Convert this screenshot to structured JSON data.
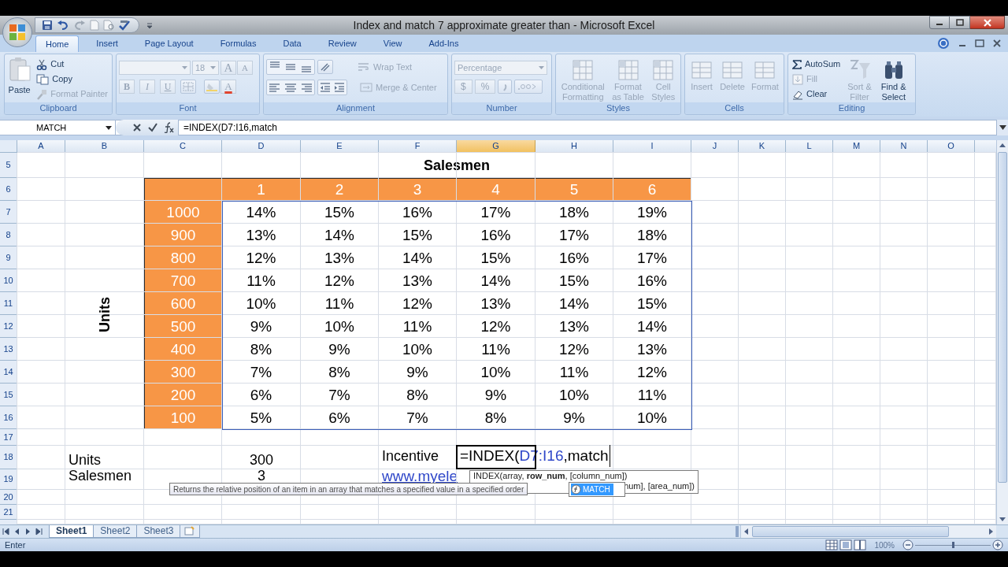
{
  "window": {
    "title": "Index and match 7 approximate greater than - Microsoft Excel"
  },
  "ribbon_tabs": [
    {
      "label": "Home",
      "selected": true
    },
    {
      "label": "Insert",
      "selected": false
    },
    {
      "label": "Page Layout",
      "selected": false
    },
    {
      "label": "Formulas",
      "selected": false
    },
    {
      "label": "Data",
      "selected": false
    },
    {
      "label": "Review",
      "selected": false
    },
    {
      "label": "View",
      "selected": false
    },
    {
      "label": "Add-Ins",
      "selected": false
    }
  ],
  "ribbon_groups": [
    {
      "kind": "clipboard",
      "label": "Clipboard",
      "items": [
        {
          "label": "Paste",
          "disabled": false
        },
        {
          "label": "Cut",
          "disabled": false
        },
        {
          "label": "Copy",
          "disabled": false
        },
        {
          "label": "Format Painter",
          "disabled": true
        }
      ]
    },
    {
      "kind": "font",
      "label": "Font",
      "font_size": "18",
      "items": [
        {
          "kind": "grow",
          "label": "A"
        },
        {
          "kind": "shrink",
          "label": "A"
        },
        {
          "kind": "bold",
          "label": "B"
        },
        {
          "kind": "italic",
          "label": "I"
        },
        {
          "kind": "underline",
          "label": "U"
        },
        {
          "kind": "color",
          "label": "A"
        }
      ]
    },
    {
      "kind": "alignment",
      "label": "Alignment",
      "items": [
        {
          "label": "Wrap Text",
          "disabled": true
        },
        {
          "label": "Merge & Center",
          "disabled": true
        }
      ]
    },
    {
      "kind": "number",
      "label": "Number",
      "format": "Percentage",
      "items": [
        {
          "label": "$"
        },
        {
          "label": "%"
        }
      ]
    },
    {
      "kind": "large",
      "label": "Styles",
      "items": [
        {
          "lines": [
            "Conditional",
            "Formatting"
          ],
          "disabled": true
        },
        {
          "lines": [
            "Format",
            "as Table"
          ],
          "disabled": true
        },
        {
          "lines": [
            "Cell",
            "Styles"
          ],
          "disabled": true
        }
      ]
    },
    {
      "kind": "large",
      "label": "Cells",
      "items": [
        {
          "lines": [
            "Insert"
          ],
          "disabled": true
        },
        {
          "lines": [
            "Delete"
          ],
          "disabled": true
        },
        {
          "lines": [
            "Format"
          ],
          "disabled": true
        }
      ]
    },
    {
      "kind": "editing",
      "label": "Editing",
      "items": [
        {
          "kind": "small",
          "label": "AutoSum",
          "disabled": false
        },
        {
          "kind": "small",
          "label": "Fill",
          "disabled": true
        },
        {
          "kind": "small",
          "label": "Clear",
          "disabled": false
        },
        {
          "kind": "large",
          "lines": [
            "Sort &",
            "Filter"
          ],
          "disabled": true
        },
        {
          "kind": "large",
          "lines": [
            "Find &",
            "Select"
          ],
          "disabled": false
        }
      ]
    }
  ],
  "formula_bar": {
    "name_box": "MATCH",
    "formula": "=INDEX(D7:I16,match"
  },
  "columns": [
    {
      "label": "A",
      "selected": false
    },
    {
      "label": "B",
      "selected": false
    },
    {
      "label": "C",
      "selected": false
    },
    {
      "label": "D",
      "selected": false
    },
    {
      "label": "E",
      "selected": false
    },
    {
      "label": "F",
      "selected": false
    },
    {
      "label": "G",
      "selected": true
    },
    {
      "label": "H",
      "selected": false
    },
    {
      "label": "I",
      "selected": false
    },
    {
      "label": "J",
      "selected": false
    },
    {
      "label": "K",
      "selected": false
    },
    {
      "label": "L",
      "selected": false
    },
    {
      "label": "M",
      "selected": false
    },
    {
      "label": "N",
      "selected": false
    },
    {
      "label": "O",
      "selected": false
    }
  ],
  "rows": [
    "5",
    "6",
    "7",
    "8",
    "9",
    "10",
    "11",
    "12",
    "13",
    "14",
    "15",
    "16",
    "17",
    "18",
    "19",
    "20",
    "21"
  ],
  "salesmen_table": {
    "title": "Salesmen",
    "axis_label": "Units",
    "salesmen": [
      "1",
      "2",
      "3",
      "4",
      "5",
      "6"
    ],
    "rows": [
      {
        "units": "1000",
        "incentives": [
          "14%",
          "15%",
          "16%",
          "17%",
          "18%",
          "19%"
        ]
      },
      {
        "units": "900",
        "incentives": [
          "13%",
          "14%",
          "15%",
          "16%",
          "17%",
          "18%"
        ]
      },
      {
        "units": "800",
        "incentives": [
          "12%",
          "13%",
          "14%",
          "15%",
          "16%",
          "17%"
        ]
      },
      {
        "units": "700",
        "incentives": [
          "11%",
          "12%",
          "13%",
          "14%",
          "15%",
          "16%"
        ]
      },
      {
        "units": "600",
        "incentives": [
          "10%",
          "11%",
          "12%",
          "13%",
          "14%",
          "15%"
        ]
      },
      {
        "units": "500",
        "incentives": [
          "9%",
          "10%",
          "11%",
          "12%",
          "13%",
          "14%"
        ]
      },
      {
        "units": "400",
        "incentives": [
          "8%",
          "9%",
          "10%",
          "11%",
          "12%",
          "13%"
        ]
      },
      {
        "units": "300",
        "incentives": [
          "7%",
          "8%",
          "9%",
          "10%",
          "11%",
          "12%"
        ]
      },
      {
        "units": "200",
        "incentives": [
          "6%",
          "7%",
          "8%",
          "9%",
          "10%",
          "11%"
        ]
      },
      {
        "units": "100",
        "incentives": [
          "5%",
          "6%",
          "7%",
          "8%",
          "9%",
          "10%"
        ]
      }
    ]
  },
  "inputs": [
    {
      "label": "Units",
      "value": "300"
    },
    {
      "label": "Salesmen",
      "value": "3"
    }
  ],
  "incentive": {
    "label": "Incentive",
    "formula_parts": [
      {
        "kind": "plain",
        "text": "=INDEX("
      },
      {
        "kind": "reference",
        "text": "D7:I16"
      },
      {
        "kind": "plain",
        "text": ",match"
      }
    ]
  },
  "link": "www.myele",
  "function_tooltip": {
    "lines": [
      "INDEX(array, **row_num**, [column_num])",
      "num], [area_num])"
    ]
  },
  "autocomplete": [
    {
      "label": "MATCH",
      "selected": true
    }
  ],
  "description_tooltip": "Returns the relative position of an item in an array that matches a specified value in a specified order",
  "sheet_tabs": [
    {
      "label": "Sheet1",
      "selected": true
    },
    {
      "label": "Sheet2",
      "selected": false
    },
    {
      "label": "Sheet3",
      "selected": false
    }
  ],
  "status_bar": {
    "mode": "Enter",
    "zoom": "100%",
    "zoom_slider": {
      "level": 0.5
    }
  }
}
